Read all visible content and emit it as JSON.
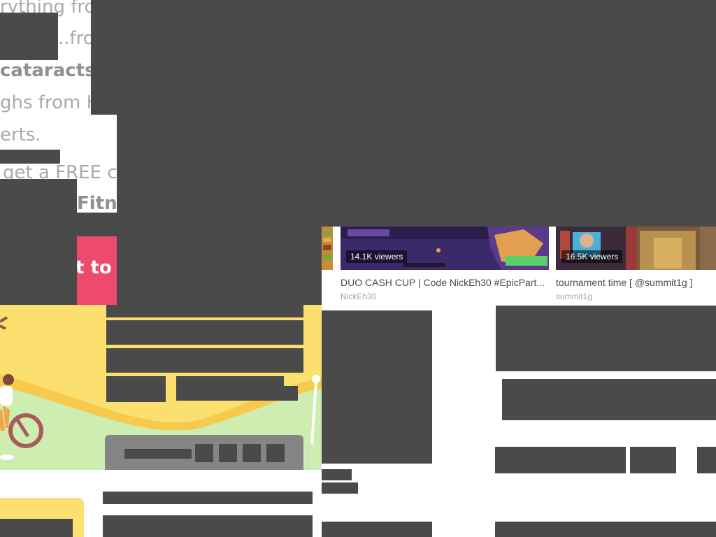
{
  "article": {
    "line1": "rything from",
    "line2": "..from",
    "line3_bold": "cataracts",
    "line3_rest": ".",
    "line4": "ghs from H",
    "line5": "erts.",
    "line6": "get a FREE c",
    "line7": "Fitne",
    "cta_label": "t to"
  },
  "videos": [
    {
      "viewers": "14.1K viewers",
      "title": "DUO CASH CUP | Code NickEh30 #EpicPart...",
      "channel": "NickEh30"
    },
    {
      "viewers": "16.5K viewers",
      "title": "tournament time [ @summit1g ]",
      "channel": "summit1g"
    }
  ],
  "colors": {
    "redaction": "#4a4a4a",
    "cta": "#f0496e",
    "illustration_yellow": "#fbe070",
    "illustration_green": "#cdeeb0"
  }
}
